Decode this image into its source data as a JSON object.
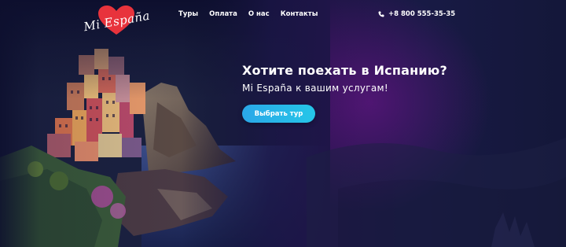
{
  "brand": {
    "logo_text": "Mi España",
    "heart_color": "#e8333c"
  },
  "nav": {
    "items": [
      {
        "label": "Туры"
      },
      {
        "label": "Оплата"
      },
      {
        "label": "О нас"
      },
      {
        "label": "Контакты"
      }
    ]
  },
  "header": {
    "phone": "+8 800 555-35-35"
  },
  "hero": {
    "title": "Хотите поехать в Испанию?",
    "subtitle": "Mi España к вашим услугам!",
    "cta_label": "Выбрать тур",
    "cta_color": "#2aa7e8"
  }
}
